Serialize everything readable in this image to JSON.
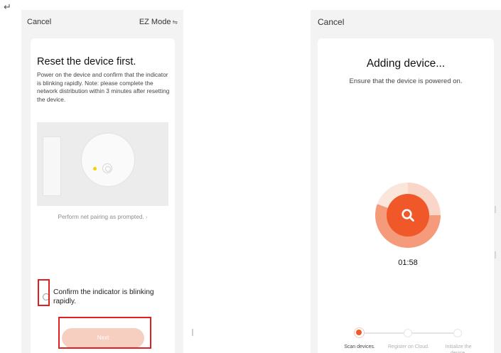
{
  "corner_glyph": "↵",
  "left_screen": {
    "cancel_label": "Cancel",
    "mode_label": "EZ Mode",
    "mode_icon": "⇋",
    "title": "Reset the device first.",
    "description": "Power on the device and confirm that the indicator is blinking rapidly. Note: please complete the network distribution within 3 minutes after resetting the device.",
    "pairing_text": "Perform net pairing as prompted.",
    "pairing_chevron": "›",
    "confirm_text": "Confirm the indicator is blinking rapidly.",
    "next_label": "Next",
    "confirm_checked": false,
    "colors": {
      "highlight": "#e02020",
      "button_disabled": "#f7cfc0",
      "indicator": "#f2d300"
    }
  },
  "right_screen": {
    "cancel_label": "Cancel",
    "title": "Adding device...",
    "subtitle": "Ensure that the device is powered on.",
    "timer": "01:58",
    "steps": [
      {
        "label": "Scan devices.",
        "active": true
      },
      {
        "label": "Register on Cloud.",
        "active": false
      },
      {
        "label": "Initialize the device.",
        "active": false
      }
    ],
    "colors": {
      "accent": "#f0582a",
      "ring": "#f59a7a"
    }
  }
}
